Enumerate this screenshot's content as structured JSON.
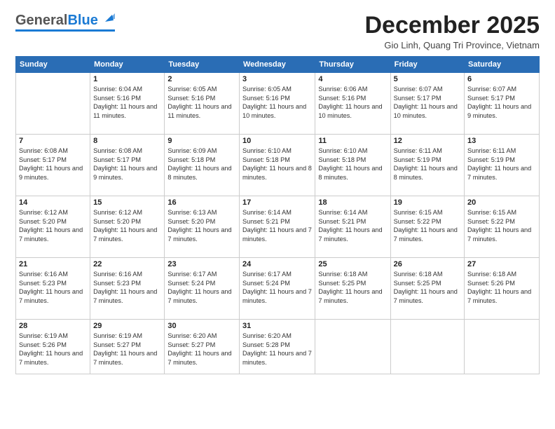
{
  "header": {
    "logo_general": "General",
    "logo_blue": "Blue",
    "month_title": "December 2025",
    "location": "Gio Linh, Quang Tri Province, Vietnam"
  },
  "days_of_week": [
    "Sunday",
    "Monday",
    "Tuesday",
    "Wednesday",
    "Thursday",
    "Friday",
    "Saturday"
  ],
  "weeks": [
    [
      {
        "day": "",
        "sunrise": "",
        "sunset": "",
        "daylight": ""
      },
      {
        "day": "1",
        "sunrise": "6:04 AM",
        "sunset": "5:16 PM",
        "daylight": "11 hours and 11 minutes."
      },
      {
        "day": "2",
        "sunrise": "6:05 AM",
        "sunset": "5:16 PM",
        "daylight": "11 hours and 11 minutes."
      },
      {
        "day": "3",
        "sunrise": "6:05 AM",
        "sunset": "5:16 PM",
        "daylight": "11 hours and 10 minutes."
      },
      {
        "day": "4",
        "sunrise": "6:06 AM",
        "sunset": "5:16 PM",
        "daylight": "11 hours and 10 minutes."
      },
      {
        "day": "5",
        "sunrise": "6:07 AM",
        "sunset": "5:17 PM",
        "daylight": "11 hours and 10 minutes."
      },
      {
        "day": "6",
        "sunrise": "6:07 AM",
        "sunset": "5:17 PM",
        "daylight": "11 hours and 9 minutes."
      }
    ],
    [
      {
        "day": "7",
        "sunrise": "6:08 AM",
        "sunset": "5:17 PM",
        "daylight": "11 hours and 9 minutes."
      },
      {
        "day": "8",
        "sunrise": "6:08 AM",
        "sunset": "5:17 PM",
        "daylight": "11 hours and 9 minutes."
      },
      {
        "day": "9",
        "sunrise": "6:09 AM",
        "sunset": "5:18 PM",
        "daylight": "11 hours and 8 minutes."
      },
      {
        "day": "10",
        "sunrise": "6:10 AM",
        "sunset": "5:18 PM",
        "daylight": "11 hours and 8 minutes."
      },
      {
        "day": "11",
        "sunrise": "6:10 AM",
        "sunset": "5:18 PM",
        "daylight": "11 hours and 8 minutes."
      },
      {
        "day": "12",
        "sunrise": "6:11 AM",
        "sunset": "5:19 PM",
        "daylight": "11 hours and 8 minutes."
      },
      {
        "day": "13",
        "sunrise": "6:11 AM",
        "sunset": "5:19 PM",
        "daylight": "11 hours and 7 minutes."
      }
    ],
    [
      {
        "day": "14",
        "sunrise": "6:12 AM",
        "sunset": "5:20 PM",
        "daylight": "11 hours and 7 minutes."
      },
      {
        "day": "15",
        "sunrise": "6:12 AM",
        "sunset": "5:20 PM",
        "daylight": "11 hours and 7 minutes."
      },
      {
        "day": "16",
        "sunrise": "6:13 AM",
        "sunset": "5:20 PM",
        "daylight": "11 hours and 7 minutes."
      },
      {
        "day": "17",
        "sunrise": "6:14 AM",
        "sunset": "5:21 PM",
        "daylight": "11 hours and 7 minutes."
      },
      {
        "day": "18",
        "sunrise": "6:14 AM",
        "sunset": "5:21 PM",
        "daylight": "11 hours and 7 minutes."
      },
      {
        "day": "19",
        "sunrise": "6:15 AM",
        "sunset": "5:22 PM",
        "daylight": "11 hours and 7 minutes."
      },
      {
        "day": "20",
        "sunrise": "6:15 AM",
        "sunset": "5:22 PM",
        "daylight": "11 hours and 7 minutes."
      }
    ],
    [
      {
        "day": "21",
        "sunrise": "6:16 AM",
        "sunset": "5:23 PM",
        "daylight": "11 hours and 7 minutes."
      },
      {
        "day": "22",
        "sunrise": "6:16 AM",
        "sunset": "5:23 PM",
        "daylight": "11 hours and 7 minutes."
      },
      {
        "day": "23",
        "sunrise": "6:17 AM",
        "sunset": "5:24 PM",
        "daylight": "11 hours and 7 minutes."
      },
      {
        "day": "24",
        "sunrise": "6:17 AM",
        "sunset": "5:24 PM",
        "daylight": "11 hours and 7 minutes."
      },
      {
        "day": "25",
        "sunrise": "6:18 AM",
        "sunset": "5:25 PM",
        "daylight": "11 hours and 7 minutes."
      },
      {
        "day": "26",
        "sunrise": "6:18 AM",
        "sunset": "5:25 PM",
        "daylight": "11 hours and 7 minutes."
      },
      {
        "day": "27",
        "sunrise": "6:18 AM",
        "sunset": "5:26 PM",
        "daylight": "11 hours and 7 minutes."
      }
    ],
    [
      {
        "day": "28",
        "sunrise": "6:19 AM",
        "sunset": "5:26 PM",
        "daylight": "11 hours and 7 minutes."
      },
      {
        "day": "29",
        "sunrise": "6:19 AM",
        "sunset": "5:27 PM",
        "daylight": "11 hours and 7 minutes."
      },
      {
        "day": "30",
        "sunrise": "6:20 AM",
        "sunset": "5:27 PM",
        "daylight": "11 hours and 7 minutes."
      },
      {
        "day": "31",
        "sunrise": "6:20 AM",
        "sunset": "5:28 PM",
        "daylight": "11 hours and 7 minutes."
      },
      {
        "day": "",
        "sunrise": "",
        "sunset": "",
        "daylight": ""
      },
      {
        "day": "",
        "sunrise": "",
        "sunset": "",
        "daylight": ""
      },
      {
        "day": "",
        "sunrise": "",
        "sunset": "",
        "daylight": ""
      }
    ]
  ],
  "labels": {
    "sunrise": "Sunrise:",
    "sunset": "Sunset:",
    "daylight": "Daylight:"
  }
}
